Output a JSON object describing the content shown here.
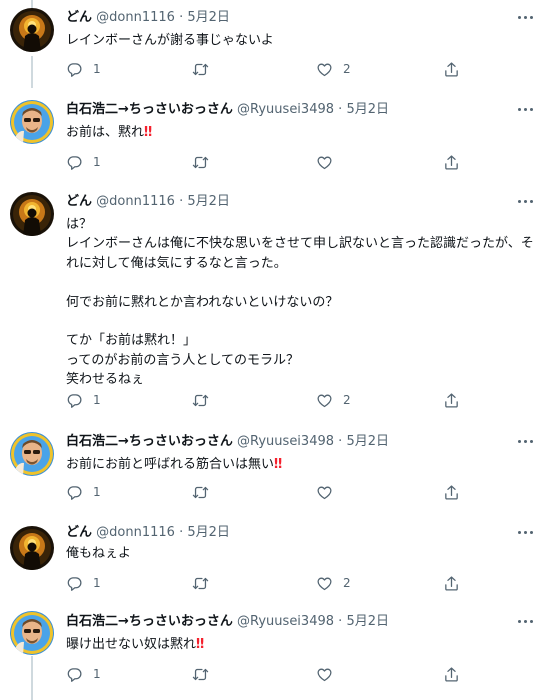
{
  "users": {
    "donn": {
      "name": "どん",
      "handle": "@donn1116"
    },
    "ryuu": {
      "name": "白石浩二→ちっさいおっさん",
      "handle": "@Ryuusei3498"
    }
  },
  "date": "5月2日",
  "dot": "·",
  "tweets": [
    {
      "text": "レインボーさんが謝る事じゃないよ",
      "reply": "1",
      "retweet": "",
      "like": "2"
    },
    {
      "text": "お前は、黙れ",
      "emoji": "‼",
      "reply": "1",
      "retweet": "",
      "like": ""
    },
    {
      "text": "は？\nレインボーさんは俺に不快な思いをさせて申し訳ないと言った認識だったが、そ\nれに対して俺は気にするなと言った。\n\n何でお前に黙れとか言われないといけないの？\n\nてか「お前は黙れ！」\nってのがお前の言う人としてのモラル？\n笑わせるねぇ",
      "reply": "1",
      "retweet": "",
      "like": "2"
    },
    {
      "text": "お前にお前と呼ばれる筋合いは無い",
      "emoji": "‼",
      "reply": "1",
      "retweet": "",
      "like": ""
    },
    {
      "text": "俺もねぇよ",
      "reply": "1",
      "retweet": "",
      "like": "2"
    },
    {
      "text": "曝け出せない奴は黙れ",
      "emoji": "‼",
      "reply": "1",
      "retweet": "",
      "like": ""
    }
  ],
  "icons": [
    "reply-icon",
    "retweet-icon",
    "like-icon",
    "share-icon",
    "more-icon"
  ]
}
